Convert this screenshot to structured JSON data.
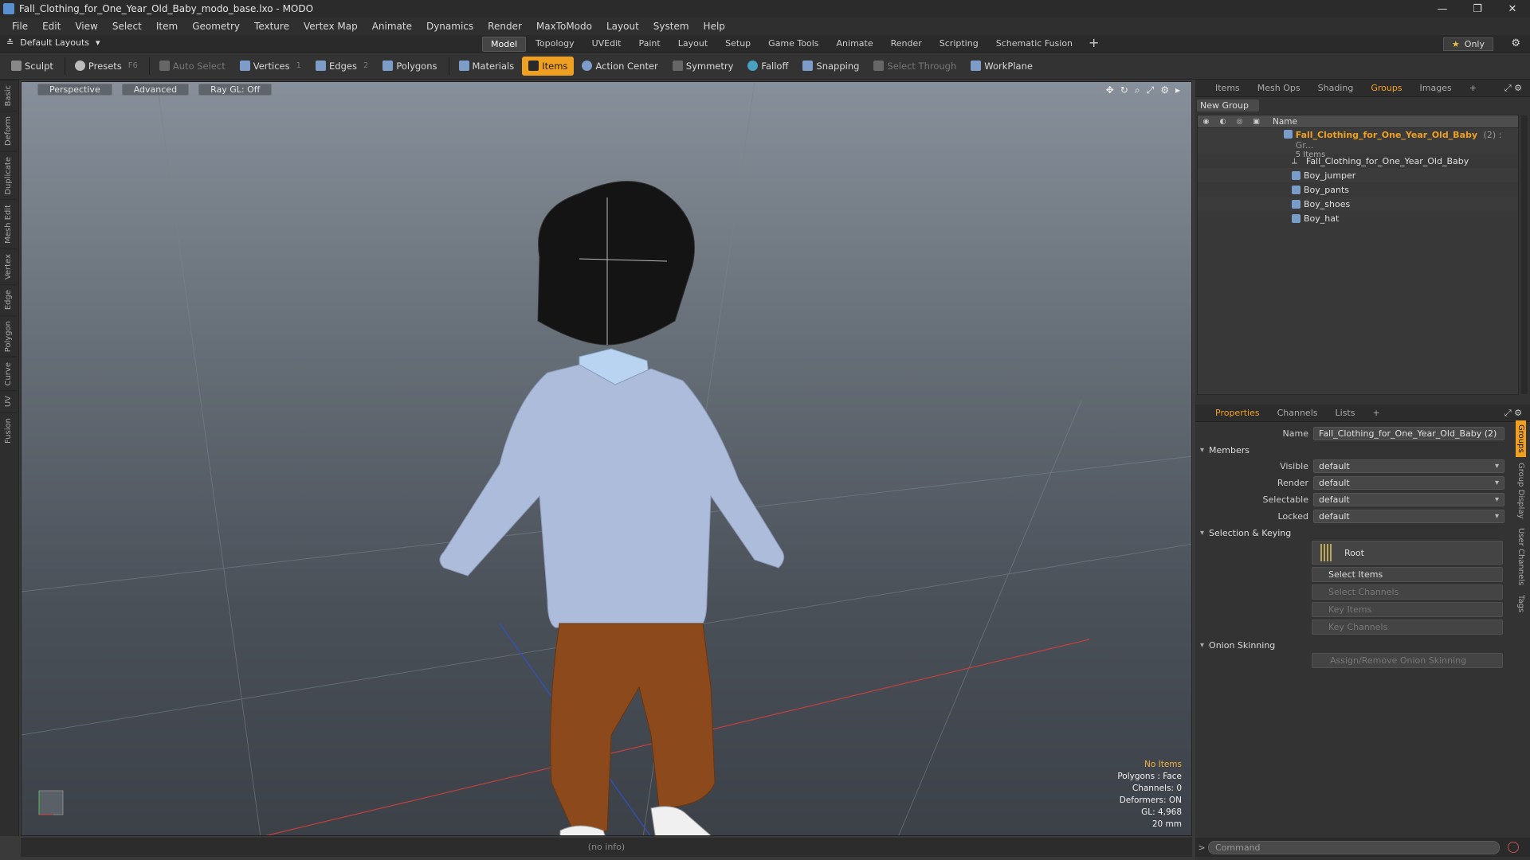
{
  "window": {
    "title": "Fall_Clothing_for_One_Year_Old_Baby_modo_base.lxo - MODO"
  },
  "menu": [
    "File",
    "Edit",
    "View",
    "Select",
    "Item",
    "Geometry",
    "Texture",
    "Vertex Map",
    "Animate",
    "Dynamics",
    "Render",
    "MaxToModo",
    "Layout",
    "System",
    "Help"
  ],
  "layout": {
    "selector": "Default Layouts",
    "tabs": [
      "Model",
      "Topology",
      "UVEdit",
      "Paint",
      "Layout",
      "Setup",
      "Game Tools",
      "Animate",
      "Render",
      "Scripting",
      "Schematic Fusion"
    ],
    "active_tab": "Model",
    "only_label": "Only"
  },
  "toolbar": {
    "sculpt": "Sculpt",
    "presets": "Presets",
    "presets_key": "F6",
    "auto_select": "Auto Select",
    "vertices": "Vertices",
    "vertices_key": "1",
    "edges": "Edges",
    "edges_key": "2",
    "polygons": "Polygons",
    "materials": "Materials",
    "items": "Items",
    "action_center": "Action Center",
    "symmetry": "Symmetry",
    "falloff": "Falloff",
    "snapping": "Snapping",
    "select_through": "Select Through",
    "workplane": "WorkPlane"
  },
  "left_tabs": [
    "Basic",
    "Deform",
    "Duplicate",
    "Mesh Edit",
    "Vertex",
    "Edge",
    "Polygon",
    "Curve",
    "UV",
    "Fusion"
  ],
  "viewport": {
    "view": "Perspective",
    "shading": "Advanced",
    "raygl": "Ray GL: Off",
    "info": {
      "items": "No Items",
      "polygons": "Polygons : Face",
      "channels": "Channels: 0",
      "deformers": "Deformers: ON",
      "gl": "GL: 4,968",
      "scale": "20 mm"
    },
    "status": "(no info)"
  },
  "groups_panel": {
    "tabs": [
      "Items",
      "Mesh Ops",
      "Shading",
      "Groups",
      "Images"
    ],
    "active_tab": "Groups",
    "new_group": "New Group",
    "col_name": "Name",
    "group_name": "Fall_Clothing_for_One_Year_Old_Baby",
    "group_suffix": "(2) : Gr...",
    "group_count": "5 Items",
    "children": [
      "Fall_Clothing_for_One_Year_Old_Baby",
      "Boy_jumper",
      "Boy_pants",
      "Boy_shoes",
      "Boy_hat"
    ]
  },
  "properties": {
    "tabs": [
      "Properties",
      "Channels",
      "Lists"
    ],
    "active_tab": "Properties",
    "name_label": "Name",
    "name_value": "Fall_Clothing_for_One_Year_Old_Baby (2)",
    "members_section": "Members",
    "visible_label": "Visible",
    "visible_value": "default",
    "render_label": "Render",
    "render_value": "default",
    "selectable_label": "Selectable",
    "selectable_value": "default",
    "locked_label": "Locked",
    "locked_value": "default",
    "sel_section": "Selection & Keying",
    "root_btn": "Root",
    "select_items": "Select Items",
    "select_channels": "Select Channels",
    "key_items": "Key Items",
    "key_channels": "Key Channels",
    "onion_section": "Onion Skinning",
    "onion_btn": "Assign/Remove Onion Skinning",
    "vtabs": [
      "Groups",
      "Group Display",
      "User Channels",
      "Tags"
    ]
  },
  "command": {
    "placeholder": "Command"
  }
}
